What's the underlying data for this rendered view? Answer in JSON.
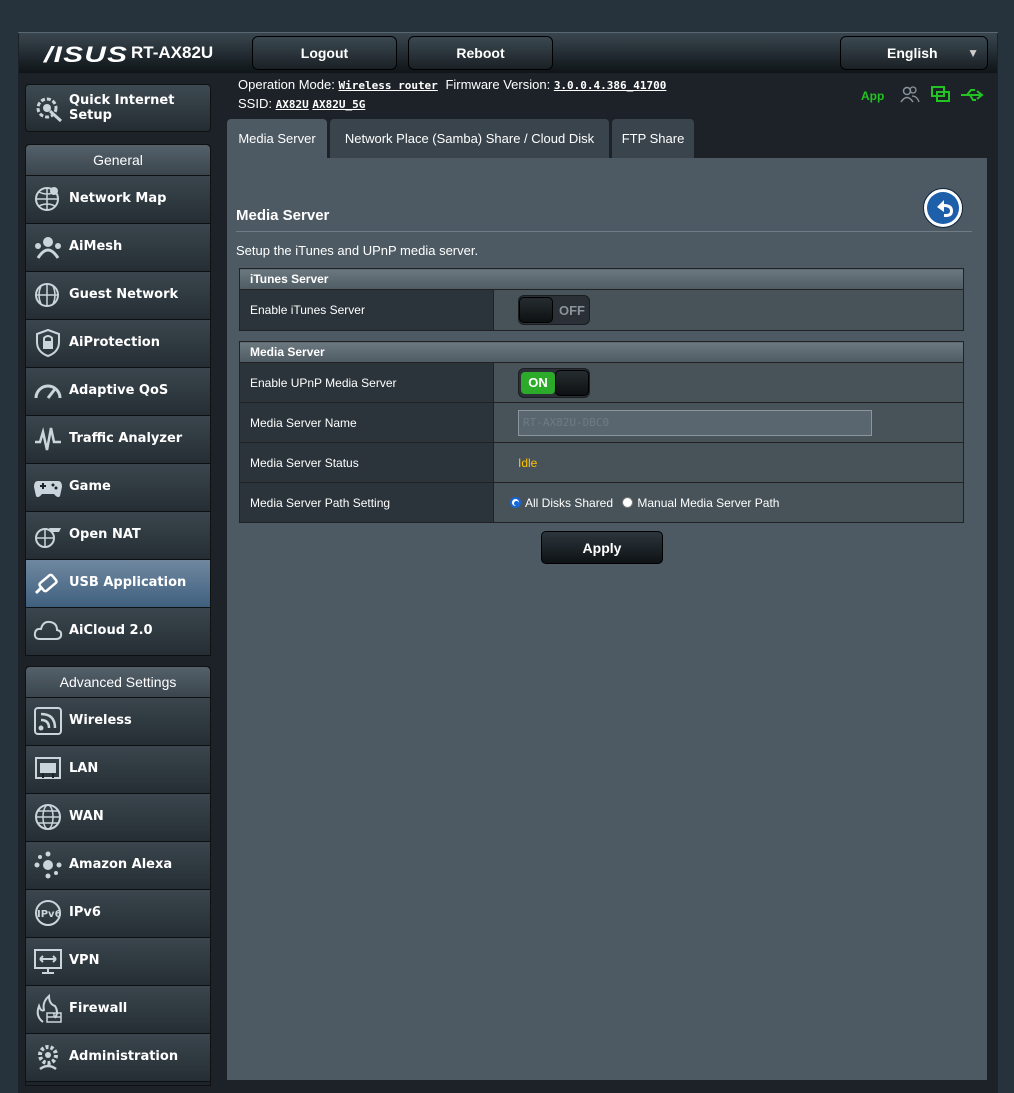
{
  "header": {
    "brand": "/ISUS",
    "model": "RT-AX82U",
    "logout_label": "Logout",
    "reboot_label": "Reboot",
    "language": "English"
  },
  "sysinfo": {
    "operation_mode_label": "Operation Mode:",
    "operation_mode_value": "Wireless router",
    "firmware_label": "Firmware Version:",
    "firmware_value": "3.0.0.4.386_41700",
    "ssid_label": "SSID:",
    "ssid_1": "AX82U",
    "ssid_2": "AX82U_5G",
    "app_label": "App"
  },
  "sidebar": {
    "quick_setup": "Quick Internet Setup",
    "general_title": "General",
    "general_items": [
      {
        "label": "Network Map",
        "icon": "network-map-icon"
      },
      {
        "label": "AiMesh",
        "icon": "aimesh-icon"
      },
      {
        "label": "Guest Network",
        "icon": "guest-network-icon"
      },
      {
        "label": "AiProtection",
        "icon": "lock-icon"
      },
      {
        "label": "Adaptive QoS",
        "icon": "gauge-icon"
      },
      {
        "label": "Traffic Analyzer",
        "icon": "traffic-icon"
      },
      {
        "label": "Game",
        "icon": "gamepad-icon"
      },
      {
        "label": "Open NAT",
        "icon": "open-nat-icon"
      },
      {
        "label": "USB Application",
        "icon": "usb-icon",
        "active": true
      },
      {
        "label": "AiCloud 2.0",
        "icon": "cloud-icon"
      }
    ],
    "advanced_title": "Advanced Settings",
    "advanced_items": [
      {
        "label": "Wireless",
        "icon": "wireless-icon"
      },
      {
        "label": "LAN",
        "icon": "lan-icon"
      },
      {
        "label": "WAN",
        "icon": "globe-icon"
      },
      {
        "label": "Amazon Alexa",
        "icon": "alexa-icon"
      },
      {
        "label": "IPv6",
        "icon": "ipv6-icon"
      },
      {
        "label": "VPN",
        "icon": "vpn-icon"
      },
      {
        "label": "Firewall",
        "icon": "firewall-icon"
      },
      {
        "label": "Administration",
        "icon": "gear-icon"
      }
    ]
  },
  "tabs": [
    "Media Server",
    "Network Place (Samba) Share / Cloud Disk",
    "FTP Share"
  ],
  "page": {
    "title": "Media Server",
    "description": "Setup the iTunes and UPnP media server.",
    "itunes_section": "iTunes Server",
    "itunes_enable_label": "Enable iTunes Server",
    "itunes_state": "OFF",
    "media_section": "Media Server",
    "upnp_enable_label": "Enable UPnP Media Server",
    "upnp_state": "ON",
    "name_label": "Media Server Name",
    "name_value": "RT-AX82U-DBC0",
    "status_label": "Media Server Status",
    "status_value": "Idle",
    "path_label": "Media Server Path Setting",
    "path_option_1": "All Disks Shared",
    "path_option_2": "Manual Media Server Path",
    "apply_label": "Apply"
  },
  "colors": {
    "status_idle": "#ffc000",
    "accent_green": "#2cab2a",
    "app_green": "#22c322"
  }
}
